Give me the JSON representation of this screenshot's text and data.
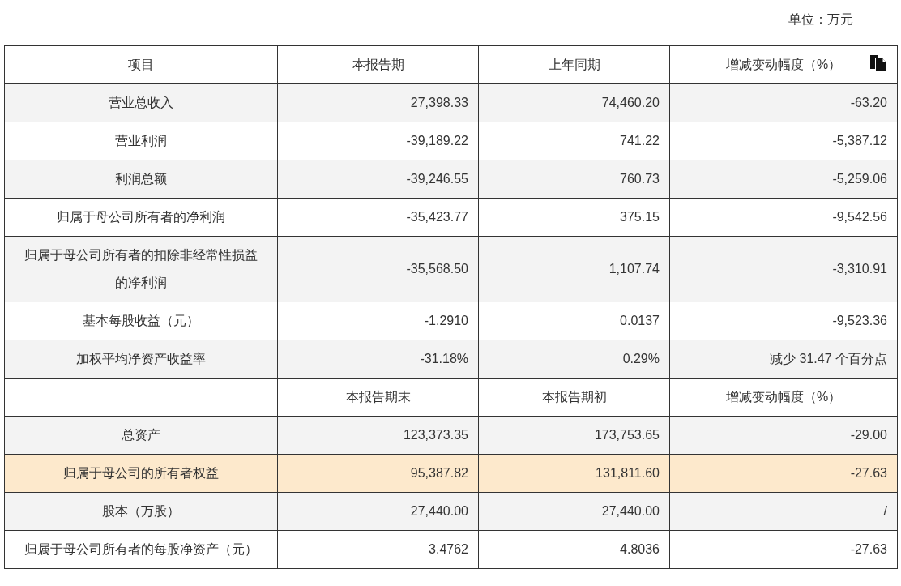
{
  "unit_label": "单位：万元",
  "table": {
    "columns": [
      "项目",
      "本报告期",
      "上年同期",
      "增减变动幅度（%）"
    ],
    "rows": [
      {
        "kind": "data",
        "highlighted": false,
        "cells": [
          "营业总收入",
          "27,398.33",
          "74,460.20",
          "-63.20"
        ]
      },
      {
        "kind": "data",
        "highlighted": false,
        "cells": [
          "营业利润",
          "-39,189.22",
          "741.22",
          "-5,387.12"
        ]
      },
      {
        "kind": "data",
        "highlighted": false,
        "cells": [
          "利润总额",
          "-39,246.55",
          "760.73",
          "-5,259.06"
        ]
      },
      {
        "kind": "data",
        "highlighted": false,
        "cells": [
          "归属于母公司所有者的净利润",
          "-35,423.77",
          "375.15",
          "-9,542.56"
        ]
      },
      {
        "kind": "data",
        "highlighted": false,
        "cells": [
          "归属于母公司所有者的扣除非经常性损益的净利润",
          "-35,568.50",
          "1,107.74",
          "-3,310.91"
        ]
      },
      {
        "kind": "data",
        "highlighted": false,
        "cells": [
          "基本每股收益（元）",
          "-1.2910",
          "0.0137",
          "-9,523.36"
        ]
      },
      {
        "kind": "data",
        "highlighted": false,
        "cells": [
          "加权平均净资产收益率",
          "-31.18%",
          "0.29%",
          "减少 31.47 个百分点"
        ]
      },
      {
        "kind": "subheader",
        "highlighted": false,
        "cells": [
          "",
          "本报告期末",
          "本报告期初",
          "增减变动幅度（%）"
        ]
      },
      {
        "kind": "data",
        "highlighted": false,
        "cells": [
          "总资产",
          "123,373.35",
          "173,753.65",
          "-29.00"
        ]
      },
      {
        "kind": "data",
        "highlighted": true,
        "cells": [
          "归属于母公司的所有者权益",
          "95,387.82",
          "131,811.60",
          "-27.63"
        ]
      },
      {
        "kind": "data",
        "highlighted": false,
        "cells": [
          "股本（万股）",
          "27,440.00",
          "27,440.00",
          "/"
        ]
      },
      {
        "kind": "data",
        "highlighted": false,
        "cells": [
          "归属于母公司所有者的每股净资产（元）",
          "3.4762",
          "4.8036",
          "-27.63"
        ]
      }
    ]
  }
}
